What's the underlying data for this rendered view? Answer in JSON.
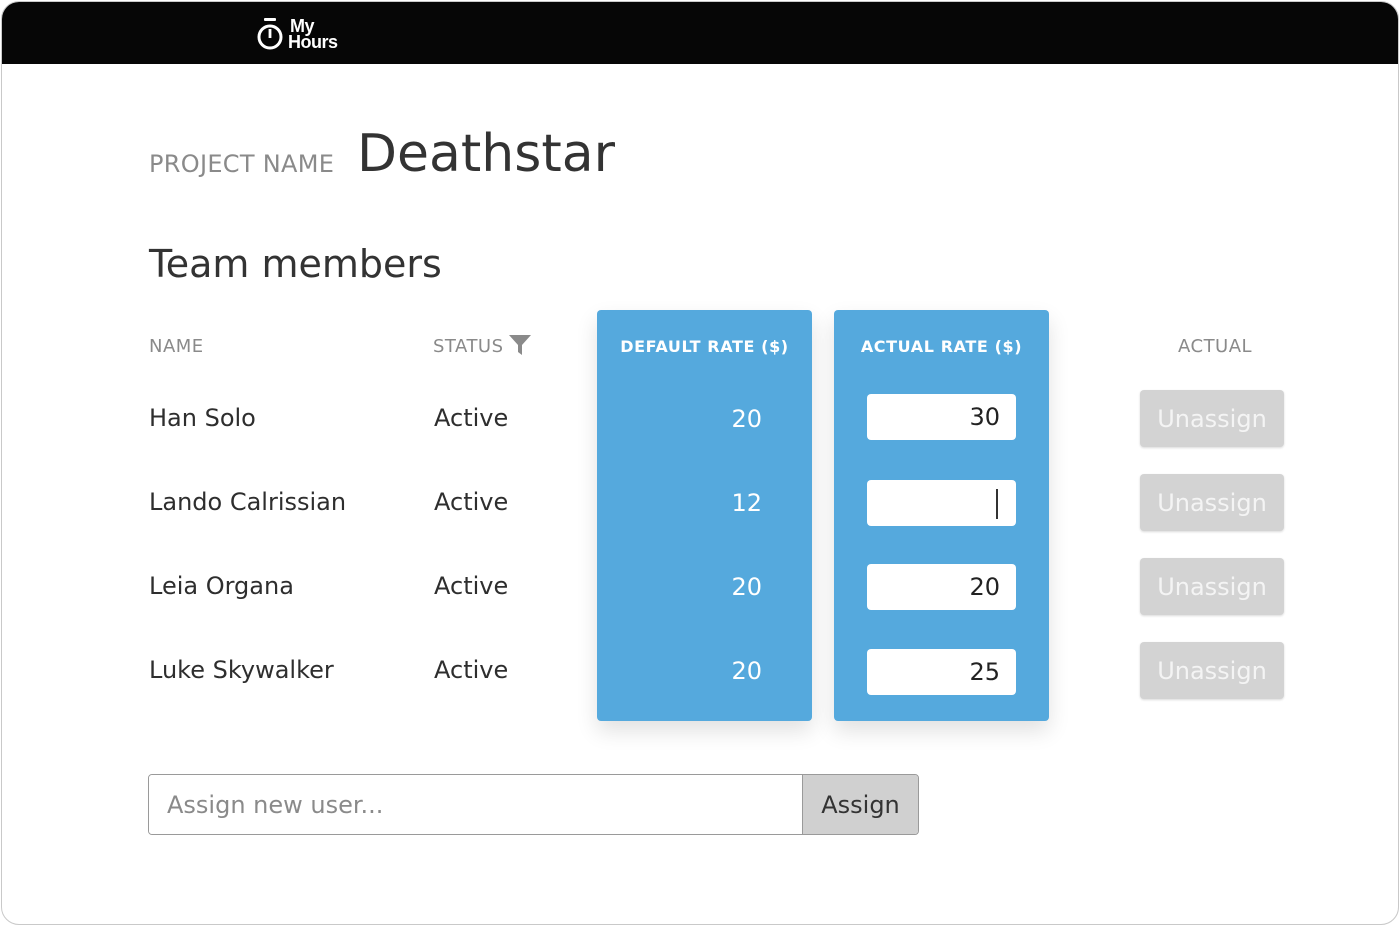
{
  "app": {
    "logo_line1": "My",
    "logo_line2": "Hours"
  },
  "project": {
    "label": "PROJECT NAME",
    "name": "Deathstar"
  },
  "section_title": "Team members",
  "table": {
    "headers": {
      "name": "NAME",
      "status": "STATUS",
      "default_rate": "DEFAULT RATE ($)",
      "actual_rate": "ACTUAL RATE ($)",
      "actual": "ACTUAL"
    },
    "rows": [
      {
        "name": "Han Solo",
        "status": "Active",
        "default_rate": "20",
        "actual_rate": "30",
        "action": "Unassign"
      },
      {
        "name": "Lando Calrissian",
        "status": "Active",
        "default_rate": "12",
        "actual_rate": "",
        "action": "Unassign"
      },
      {
        "name": "Leia Organa",
        "status": "Active",
        "default_rate": "20",
        "actual_rate": "20",
        "action": "Unassign"
      },
      {
        "name": "Luke Skywalker",
        "status": "Active",
        "default_rate": "20",
        "actual_rate": "25",
        "action": "Unassign"
      }
    ]
  },
  "assign": {
    "placeholder": "Assign new user...",
    "button_label": "Assign"
  },
  "colors": {
    "topbar": "#060606",
    "rate_column": "#55a9dd",
    "unassign_button": "#d3d3d3",
    "assign_button": "#d0d0d0"
  },
  "icons": {
    "logo": "stopwatch-icon",
    "status_filter": "filter-icon"
  }
}
